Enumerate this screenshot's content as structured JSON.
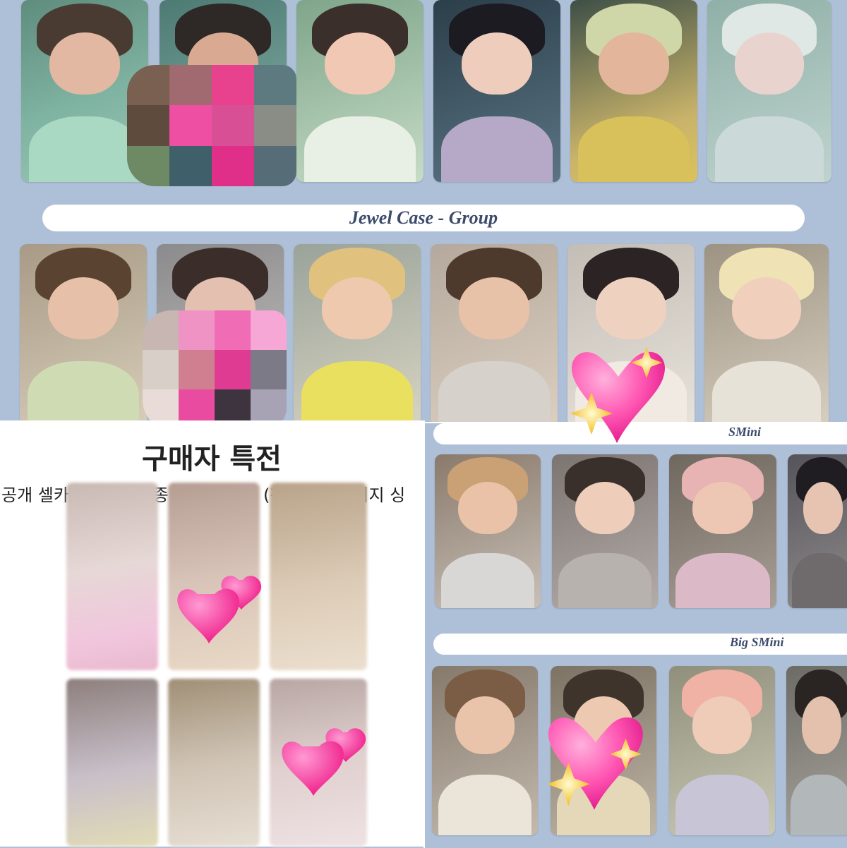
{
  "sections": {
    "jewel_group_label": "Jewel Case - Group",
    "smini_label": "SMini",
    "big_smini_label": "Big SMini"
  },
  "benefit": {
    "heading": "구매자 특전",
    "subline": "공개 셀카 포토카드 6종 중 랜덤 1종 (판매처별 이미지 싱"
  },
  "icons": {
    "heart": "sparkling-heart-emoji",
    "hearts": "two-hearts-emoji",
    "mosaic": "pixel-censor-mosaic"
  },
  "colors": {
    "background": "#aebfd8",
    "pill": "#ffffff",
    "label_text": "#3c4a6a",
    "heart_pink": "#ff4fae"
  }
}
